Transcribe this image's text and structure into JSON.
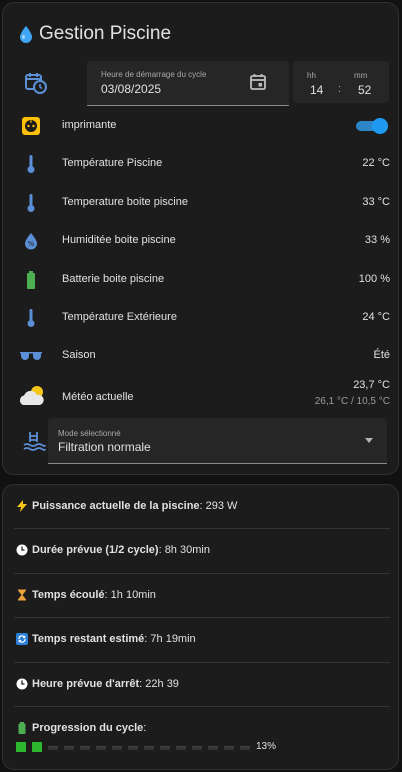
{
  "card_main": {
    "title": "Gestion Piscine",
    "date_label": "Heure de démarrage du cycle",
    "date_value": "03/08/2025",
    "hh_label": "hh",
    "mm_label": "mm",
    "hh_value": "14",
    "mm_value": "52",
    "time_sep": ":",
    "rows": [
      {
        "name": "imprimante",
        "value": ""
      },
      {
        "name": "Température Piscine",
        "value": "22 °C"
      },
      {
        "name": "Temperature boite piscine",
        "value": "33 °C"
      },
      {
        "name": "Humiditée boite piscine",
        "value": "33 %"
      },
      {
        "name": "Batterie boite piscine",
        "value": "100 %"
      },
      {
        "name": "Température Extérieure",
        "value": "24 °C"
      },
      {
        "name": "Saison",
        "value": "Été"
      },
      {
        "name": "Météo actuelle",
        "value": "23,7 °C",
        "sub": "26,1 °C / 10,5 °C"
      }
    ],
    "toggle_on": true,
    "mode_label": "Mode sélectionné",
    "mode_value": "Filtration normale"
  },
  "card_info": {
    "power_label": "Puissance actuelle de la piscine",
    "power_value": " : 293 W",
    "duration_label": "Durée prévue (1/2 cycle)",
    "duration_value": " : 8h 30min",
    "elapsed_label": "Temps écoulé",
    "elapsed_value": " : 1h 10min",
    "remaining_label": "Temps restant estimé",
    "remaining_value": " : 7h 19min",
    "stop_label": "Heure prévue d'arrêt",
    "stop_value": " : 22h 39",
    "progress_label": "Progression du cycle",
    "progress_value": " :",
    "progress_percent": "13%",
    "progress_fraction": 0.13
  },
  "colors": {
    "accent": "#1e9bf0",
    "thermo": "#5b8fd6",
    "battery": "#4caf50",
    "plug_bg": "#ffc107"
  }
}
